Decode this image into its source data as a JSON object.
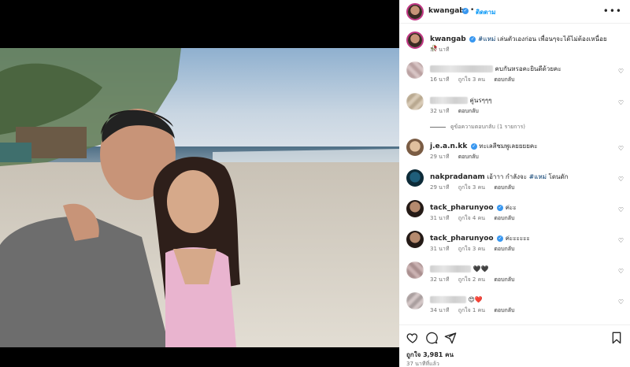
{
  "post": {
    "username": "kwangab",
    "follow_label": "ติดตาม",
    "more_icon": "more-horizontal-icon",
    "caption_hashtag": "#แหม่",
    "caption_text": " เล่นตัวเองก่อน เพื่อนๆจะได้ไม่ต้องเหนื่อย 🥀",
    "caption_time": "37 นาที",
    "likes": "ถูกใจ 3,981 คน",
    "time_ago": "37 นาทีที่แล้ว"
  },
  "comments": [
    {
      "user": "",
      "text": "คบกันหรอคะยินดีด้วยคะ",
      "time": "16 นาที",
      "likes": "ถูกใจ 3 คน",
      "reply": "ตอบกลับ"
    },
    {
      "user": "",
      "text": "คู่นรๆๆๆ",
      "time": "32 นาที",
      "likes": "",
      "reply": "ตอบกลับ",
      "view_replies": "ดูข้อความตอบกลับ (1 รายการ)"
    },
    {
      "user": "j.e.a.n.kk",
      "text": "ทะเลสีชมพูเลยยยยคะ",
      "time": "29 นาที",
      "likes": "",
      "reply": "ตอบกลับ"
    },
    {
      "user": "nakpradanam",
      "text": "เอ้าาา กำลังจะ ",
      "hashtag": "#แหม่",
      "text_after": " โดนดัก",
      "time": "29 นาที",
      "likes": "ถูกใจ 3 คน",
      "reply": "ตอบกลับ"
    },
    {
      "user": "tack_pharunyoo",
      "text": "ค่ะะ",
      "time": "31 นาที",
      "likes": "ถูกใจ 4 คน",
      "reply": "ตอบกลับ"
    },
    {
      "user": "tack_pharunyoo",
      "text": "ค่ะะะะะะ",
      "time": "31 นาที",
      "likes": "ถูกใจ 3 คน",
      "reply": "ตอบกลับ"
    },
    {
      "user": "",
      "text": "🖤🖤",
      "time": "32 นาที",
      "likes": "ถูกใจ 2 คน",
      "reply": "ตอบกลับ"
    },
    {
      "user": "",
      "text": "😍❤️",
      "time": "34 นาที",
      "likes": "ถูกใจ 1 คน",
      "reply": "ตอบกลับ"
    }
  ],
  "actions": {
    "like_icon": "heart-icon",
    "comment_icon": "comment-icon",
    "share_icon": "share-icon",
    "save_icon": "bookmark-icon"
  },
  "colors": {
    "accent": "#0095f6",
    "verified": "#3897f0",
    "hashtag": "#00376b",
    "muted": "#737373"
  }
}
